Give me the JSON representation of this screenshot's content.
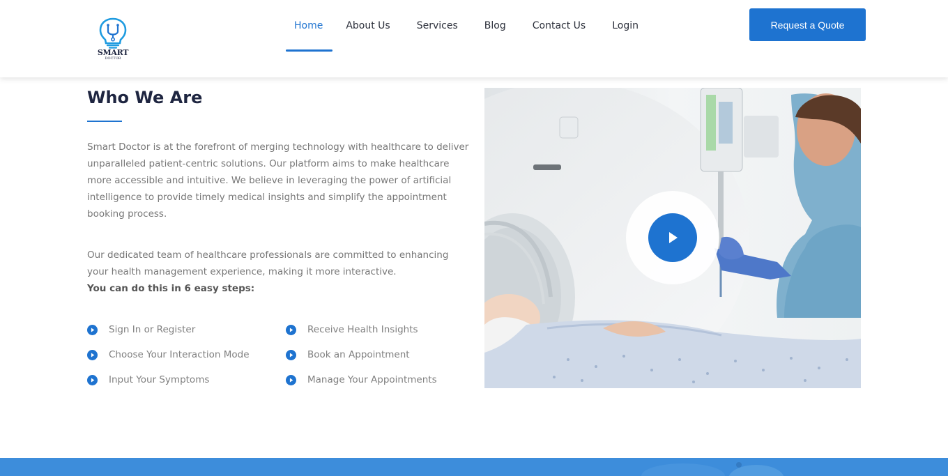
{
  "brand": {
    "name": "SMART",
    "sub": "DOCTOR",
    "icon": "lightbulb-stethoscope-icon",
    "accent_color": "#1e73d0"
  },
  "nav": {
    "items": [
      {
        "label": "Home",
        "active": true
      },
      {
        "label": "About Us",
        "active": false
      },
      {
        "label": "Services",
        "active": false
      },
      {
        "label": "Blog",
        "active": false
      },
      {
        "label": "Contact Us",
        "active": false
      },
      {
        "label": "Login",
        "active": false
      }
    ],
    "cta_label": "Request a Quote"
  },
  "about": {
    "title": "Who We Are",
    "paragraph1": "Smart Doctor is at the forefront of merging technology with healthcare to deliver unparalleled patient-centric solutions. Our platform aims to make healthcare more accessible and intuitive. We believe in leveraging the power of artificial intelligence to provide timely medical insights and simplify the appointment booking process.",
    "paragraph2": "Our dedicated team of healthcare professionals are committed to enhancing your health management experience, making it more interactive.",
    "steps_intro": "You can do this in 6 easy steps:",
    "steps": [
      "Sign In or Register",
      "Choose Your Interaction Mode",
      "Input Your Symptoms",
      "Receive Health Insights",
      "Book an Appointment",
      "Manage Your Appointments"
    ],
    "bullet_icon": "play-circle-icon"
  },
  "video": {
    "icon": "play-icon"
  }
}
